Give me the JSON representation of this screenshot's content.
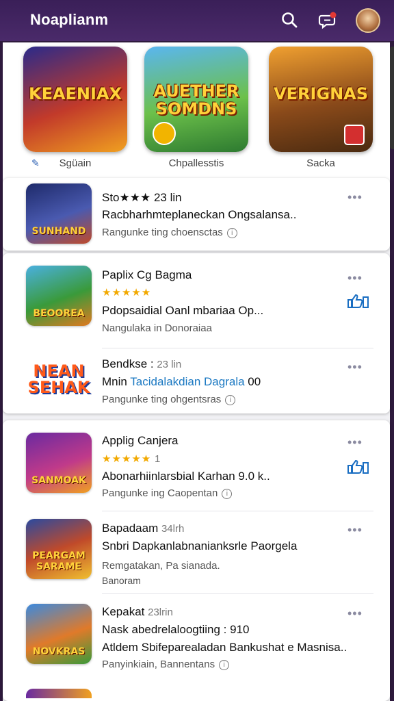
{
  "header": {
    "title": "Noaplianm"
  },
  "featured": [
    {
      "title": "KEAENIAX",
      "caption": "Sgüain",
      "bg": "linear-gradient(160deg,#2a2a8a,#c23a2a 55%,#f0a020)"
    },
    {
      "title": "AUETHER SOMDNS",
      "caption": "Chpallesstis",
      "bg": "linear-gradient(170deg,#5ab6f0,#6cc04a 55%,#2d7a30)"
    },
    {
      "title": "VERIGNAS",
      "caption": "Sacka",
      "bg": "linear-gradient(170deg,#f0a030,#8a4a1a 55%,#4a2a10)"
    }
  ],
  "items": [
    {
      "thumb_label": "SUNHAND",
      "meta": "Sto★★★  23 lin",
      "line1": "Racbharhmteplaneckan Ongsalansa..",
      "line2": "Rangunke ting choensctas"
    },
    {
      "thumb_label": "BEOOREA",
      "title": "Paplix Cg Bagma",
      "stars": "★★★★★",
      "line1": "Pdopsaidial Oanl mbariaa  Op...",
      "line2": "Nangulaka in Donoraiaa"
    },
    {
      "thumb_label": "NEAN SEHAK",
      "title": "Bendkse :",
      "meta": "23 lin",
      "line1_a": "Mnin",
      "line1_b": "Tacidalakdian Dagrala",
      "line1_c": "00",
      "line2": "Pangunke ting ohgentsras"
    },
    {
      "thumb_label": "SANMOAK",
      "title": "Applig Canjera",
      "stars": "★★★★★",
      "meta": "1",
      "line1": "Abonarhiinlarsbial Karhan 9.0 k..",
      "line2": "Pangunke ing Caopentan"
    },
    {
      "thumb_label": "PEARGAM SARAME",
      "title": "Bapadaam",
      "meta": "34lrh",
      "line1": "Snbri Dapkanlabnanianksrle Paorgela",
      "line2": "Remgatakan, Pa sianada.",
      "line3": "Banoram"
    },
    {
      "thumb_label": "NOVKRAS",
      "title": "Kepakat",
      "meta": "23lrin",
      "line1": "Nask abedrelaloogtiing : 910",
      "line2": "Atldem Sbifeparealadan Bankushat e Masnisa..",
      "line3": "Panyinkiain, Bannentans"
    }
  ]
}
